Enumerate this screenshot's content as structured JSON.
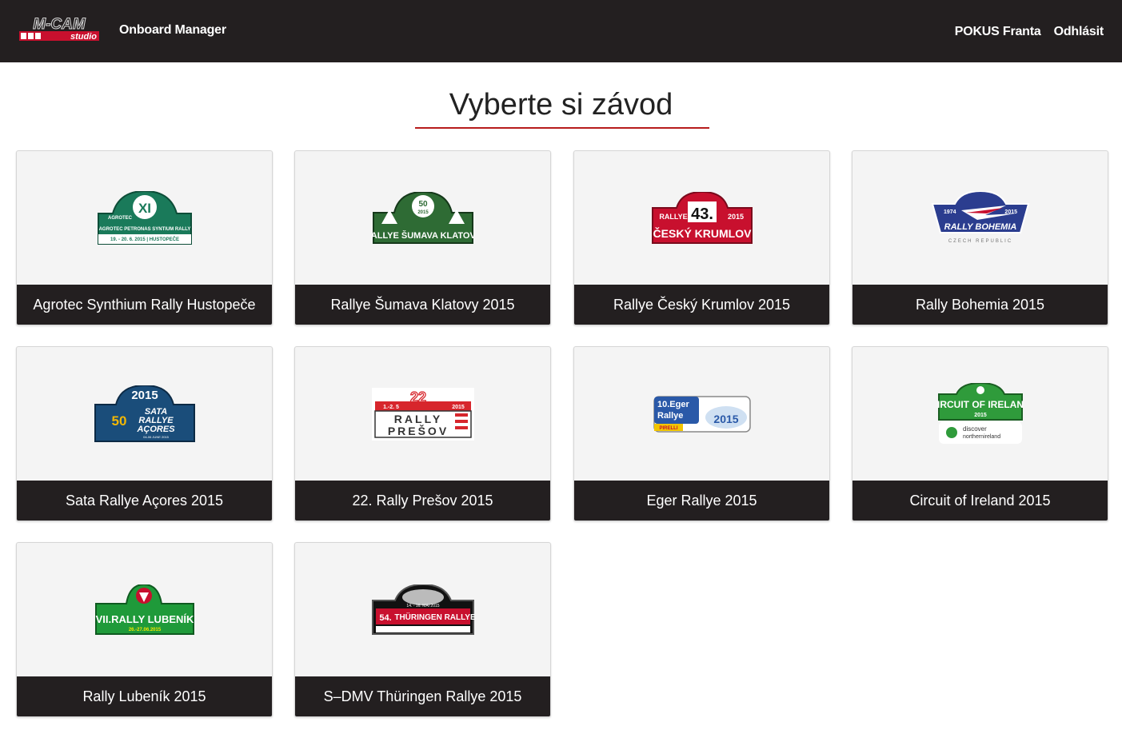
{
  "header": {
    "brand_logo_text_top": "M-CAM",
    "brand_logo_text_bottom": "studio",
    "app_name": "Onboard Manager",
    "user_name": "POKUS Franta",
    "logout_label": "Odhlásit"
  },
  "page": {
    "title": "Vyberte si závod"
  },
  "events": [
    {
      "name": "Agrotec Synthium Rally Hustopeče",
      "logo": {
        "roman": "XI",
        "brand": "AGROTEC",
        "line": "AGROTEC PETRONAS SYNTIUM RALLY",
        "date": "19. - 20. 6. 2015 | HUSTOPEČE",
        "color": "#1a7a5a"
      }
    },
    {
      "name": "Rallye Šumava Klatovy 2015",
      "logo": {
        "badge": "50",
        "year": "2015",
        "line": "RALLYE ŠUMAVA KLATOVY",
        "color": "#2e6b34"
      }
    },
    {
      "name": "Rallye Český Krumlov 2015",
      "logo": {
        "top_left": "RALLYE",
        "number": "43.",
        "year": "2015",
        "line": "ČESKÝ KRUMLOV",
        "color": "#c8102e"
      }
    },
    {
      "name": "Rally Bohemia 2015",
      "logo": {
        "from": "1974",
        "to": "2015",
        "line": "RALLY BOHEMIA",
        "sub": "CZECH REPUBLIC",
        "color": "#2b3d8f"
      }
    },
    {
      "name": "Sata Rallye Açores 2015",
      "logo": {
        "year": "2015",
        "badge": "50",
        "line1": "SATA",
        "line2": "RALLYE",
        "line3": "AÇORES",
        "date": "04-06 JUNE 2015",
        "color": "#1a4d7a"
      }
    },
    {
      "name": "22. Rally Prešov 2015",
      "logo": {
        "number": "22",
        "date": "1.-2. 5",
        "year": "2015",
        "line1": "RALLY",
        "line2": "PREŠOV",
        "color": "#d7262c"
      }
    },
    {
      "name": "Eger Rallye 2015",
      "logo": {
        "line1": "10.Eger",
        "line2": "Rallye",
        "year": "2015",
        "sponsor": "PIRELLI",
        "color": "#2a59a8"
      }
    },
    {
      "name": "Circuit of Ireland 2015",
      "logo": {
        "line": "CIRCUIT OF IRELAND",
        "year": "2015",
        "sub1": "discover",
        "sub2": "northernireland",
        "color": "#2f9b3b"
      }
    },
    {
      "name": "Rally Lubeník 2015",
      "logo": {
        "line": "VII.RALLY LUBENÍK",
        "date": "26.-27.06.2015",
        "color": "#1f9a3a"
      }
    },
    {
      "name": "S–DMV Thüringen Rallye 2015",
      "logo": {
        "number": "54.",
        "line": "THÜRINGEN RALLYE",
        "date": "14. - 16. MAI 2015",
        "color": "#c8102e"
      }
    }
  ]
}
